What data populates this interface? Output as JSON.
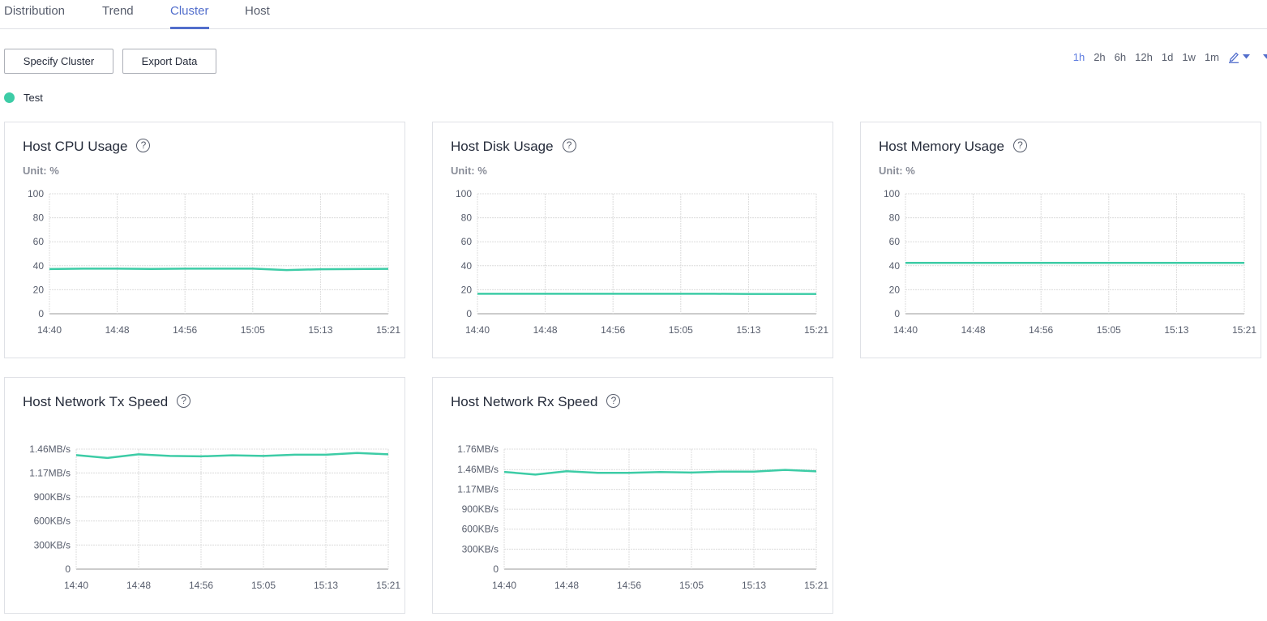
{
  "tabs": [
    {
      "label": "Distribution",
      "active": false
    },
    {
      "label": "Trend",
      "active": false
    },
    {
      "label": "Cluster",
      "active": true
    },
    {
      "label": "Host",
      "active": false
    }
  ],
  "toolbar": {
    "specify_cluster_label": "Specify Cluster",
    "export_data_label": "Export Data"
  },
  "time_ranges": [
    {
      "label": "1h",
      "active": true
    },
    {
      "label": "2h",
      "active": false
    },
    {
      "label": "6h",
      "active": false
    },
    {
      "label": "12h",
      "active": false
    },
    {
      "label": "1d",
      "active": false
    },
    {
      "label": "1w",
      "active": false
    },
    {
      "label": "1m",
      "active": false
    }
  ],
  "icons": {
    "custom_range": "pencil-icon",
    "dropdown": "caret-down-icon",
    "help": "question-circle-icon"
  },
  "legend": {
    "label": "Test",
    "color": "#3dcca6"
  },
  "colors": {
    "accent": "#526ecc",
    "series": "#3dcca6"
  },
  "help_glyph": "?",
  "chart_data": [
    {
      "type": "line",
      "title": "Host CPU Usage",
      "unit_label": "Unit: %",
      "xlabel": "",
      "ylabel": "%",
      "ylim": [
        0,
        100
      ],
      "yticks": [
        0,
        20,
        40,
        60,
        80,
        100
      ],
      "ytick_labels": [
        "0",
        "20",
        "40",
        "60",
        "80",
        "100"
      ],
      "xtick_labels": [
        "14:40",
        "14:48",
        "14:56",
        "15:05",
        "15:13",
        "15:21"
      ],
      "grid": true,
      "series": [
        {
          "name": "Test",
          "values": [
            37.2,
            37.6,
            37.6,
            37.3,
            37.6,
            37.6,
            37.6,
            36.4,
            37.1,
            37.2,
            37.4
          ]
        }
      ]
    },
    {
      "type": "line",
      "title": "Host Disk Usage",
      "unit_label": "Unit: %",
      "xlabel": "",
      "ylabel": "%",
      "ylim": [
        0,
        100
      ],
      "yticks": [
        0,
        20,
        40,
        60,
        80,
        100
      ],
      "ytick_labels": [
        "0",
        "20",
        "40",
        "60",
        "80",
        "100"
      ],
      "xtick_labels": [
        "14:40",
        "14:48",
        "14:56",
        "15:05",
        "15:13",
        "15:21"
      ],
      "grid": true,
      "series": [
        {
          "name": "Test",
          "values": [
            16.6,
            16.6,
            16.6,
            16.6,
            16.6,
            16.6,
            16.6,
            16.6,
            16.5,
            16.5,
            16.5
          ]
        }
      ]
    },
    {
      "type": "line",
      "title": "Host Memory Usage",
      "unit_label": "Unit: %",
      "xlabel": "",
      "ylabel": "%",
      "ylim": [
        0,
        100
      ],
      "yticks": [
        0,
        20,
        40,
        60,
        80,
        100
      ],
      "ytick_labels": [
        "0",
        "20",
        "40",
        "60",
        "80",
        "100"
      ],
      "xtick_labels": [
        "14:40",
        "14:48",
        "14:56",
        "15:05",
        "15:13",
        "15:21"
      ],
      "grid": true,
      "series": [
        {
          "name": "Test",
          "values": [
            42.4,
            42.4,
            42.4,
            42.4,
            42.4,
            42.4,
            42.4,
            42.4,
            42.4,
            42.4,
            42.4
          ]
        }
      ]
    },
    {
      "type": "line",
      "title": "Host Network Tx Speed",
      "unit_label": "",
      "xlabel": "",
      "ylabel": "KB/s",
      "ylim": [
        0,
        1495
      ],
      "yticks": [
        0,
        300,
        600,
        900,
        1198,
        1495
      ],
      "ytick_labels": [
        "0",
        "300KB/s",
        "600KB/s",
        "900KB/s",
        "1.17MB/s",
        "1.46MB/s"
      ],
      "xtick_labels": [
        "14:40",
        "14:48",
        "14:56",
        "15:05",
        "15:13",
        "15:21"
      ],
      "grid": true,
      "series": [
        {
          "name": "Test",
          "values": [
            1420,
            1385,
            1430,
            1410,
            1405,
            1418,
            1410,
            1425,
            1425,
            1448,
            1430
          ]
        }
      ]
    },
    {
      "type": "line",
      "title": "Host Network Rx Speed",
      "unit_label": "",
      "xlabel": "",
      "ylabel": "KB/s",
      "ylim": [
        0,
        1802
      ],
      "yticks": [
        0,
        300,
        600,
        900,
        1198,
        1495,
        1802
      ],
      "ytick_labels": [
        "0",
        "300KB/s",
        "600KB/s",
        "900KB/s",
        "1.17MB/s",
        "1.46MB/s",
        "1.76MB/s"
      ],
      "xtick_labels": [
        "14:40",
        "14:48",
        "14:56",
        "15:05",
        "15:13",
        "15:21"
      ],
      "grid": true,
      "series": [
        {
          "name": "Test",
          "values": [
            1460,
            1420,
            1470,
            1445,
            1445,
            1458,
            1450,
            1465,
            1465,
            1490,
            1468
          ]
        }
      ]
    }
  ]
}
